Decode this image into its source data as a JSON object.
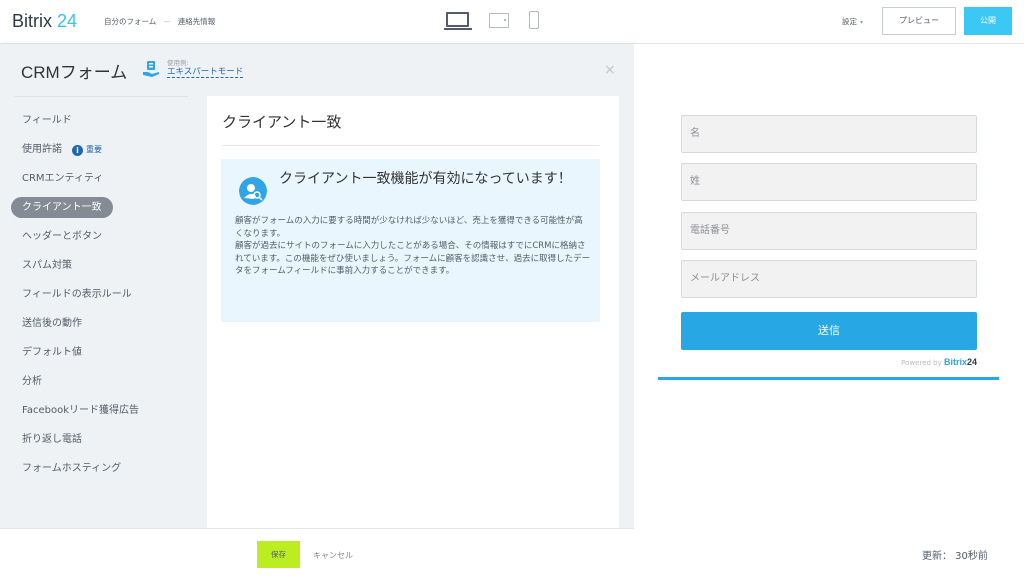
{
  "header": {
    "logo_text": "Bitrix",
    "logo_num": "24",
    "breadcrumb": [
      "自分のフォーム",
      "連絡先情報"
    ],
    "breadcrumb_sep": "—",
    "settings_label": "設定",
    "preview_label": "プレビュー",
    "publish_label": "公開",
    "devices": [
      "desktop-icon",
      "tablet-icon",
      "phone-icon"
    ]
  },
  "editor": {
    "title": "CRMフォーム",
    "mode_caption": "使用例:",
    "mode_link": "エキスパートモード",
    "close": "×",
    "nav": [
      {
        "label": "フィールド"
      },
      {
        "label": "使用許諾",
        "badge": "重要",
        "badge_icon": "i"
      },
      {
        "label": "CRMエンティティ"
      },
      {
        "label": "クライアント一致",
        "active": true
      },
      {
        "label": "ヘッダーとボタン"
      },
      {
        "label": "スパム対策"
      },
      {
        "label": "フィールドの表示ルール"
      },
      {
        "label": "送信後の動作"
      },
      {
        "label": "デフォルト値"
      },
      {
        "label": "分析"
      },
      {
        "label": "Facebookリード獲得広告"
      },
      {
        "label": "折り返し電話"
      },
      {
        "label": "フォームホスティング"
      }
    ],
    "content": {
      "heading": "クライアント一致",
      "info_title": "クライアント一致機能が有効になっています！",
      "info_text": "顧客がフォームの入力に要する時間が少なければ少ないほど、売上を獲得できる可能性が高くなります。\n顧客が過去にサイトのフォームに入力したことがある場合、その情報はすでにCRMに格納されています。この機能をぜひ使いましょう。フォームに顧客を認識させ、過去に取得したデータをフォームフィールドに事前入力することができます。"
    },
    "footer": {
      "save_label": "保存",
      "cancel_label": "キャンセル"
    }
  },
  "preview": {
    "fields": [
      "名",
      "姓",
      "電話番号",
      "メールアドレス"
    ],
    "submit_label": "送信",
    "powered_by": "Powered by",
    "powered_brand": "Bitrix",
    "powered_num": "24",
    "updated_label": "更新：  30秒前"
  },
  "colors": {
    "accent": "#27a8e5",
    "publish": "#3bc8f5",
    "save": "#bbed21",
    "active_nav": "#848b94",
    "info_bg": "#e9f6fd"
  }
}
